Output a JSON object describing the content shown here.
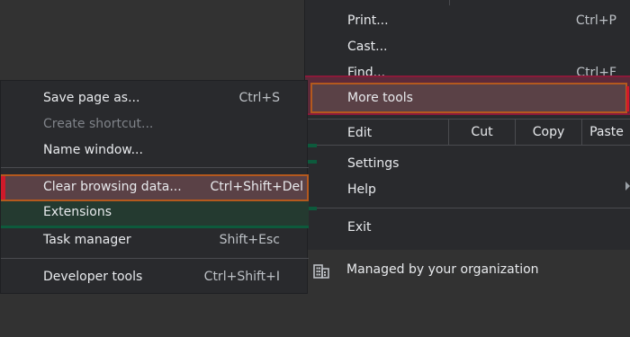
{
  "main_menu": {
    "items": [
      {
        "label": "Print...",
        "shortcut": "Ctrl+P"
      },
      {
        "label": "Cast...",
        "shortcut": ""
      },
      {
        "label": "Find...",
        "shortcut": "Ctrl+F"
      },
      {
        "label": "More tools",
        "shortcut": ""
      },
      {
        "label": "Edit",
        "shortcut": ""
      },
      {
        "label": "Settings",
        "shortcut": ""
      },
      {
        "label": "Help",
        "shortcut": ""
      },
      {
        "label": "Exit",
        "shortcut": ""
      }
    ],
    "edit_actions": [
      "Cut",
      "Copy",
      "Paste"
    ],
    "managed_label": "Managed by your organization"
  },
  "sub_menu": {
    "items": [
      {
        "label": "Save page as...",
        "shortcut": "Ctrl+S",
        "enabled": true
      },
      {
        "label": "Create shortcut...",
        "shortcut": "",
        "enabled": false
      },
      {
        "label": "Name window...",
        "shortcut": "",
        "enabled": true
      },
      {
        "label": "Clear browsing data...",
        "shortcut": "Ctrl+Shift+Del",
        "enabled": true
      },
      {
        "label": "Extensions",
        "shortcut": "",
        "enabled": true
      },
      {
        "label": "Task manager",
        "shortcut": "Shift+Esc",
        "enabled": true
      },
      {
        "label": "Developer tools",
        "shortcut": "Ctrl+Shift+I",
        "enabled": true
      }
    ]
  },
  "colors": {
    "menu_bg": "#292a2d",
    "highlight_orange": "#b4591e",
    "highlight_red": "#d01a2a",
    "highlight_green": "#0d5a3c"
  }
}
